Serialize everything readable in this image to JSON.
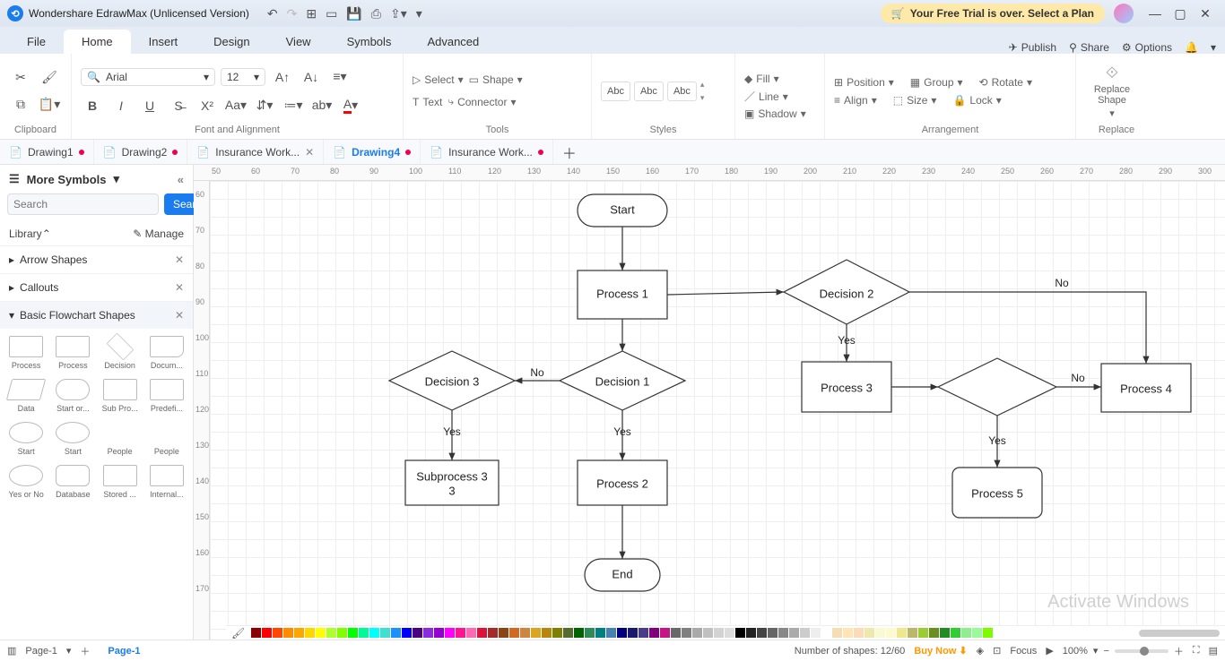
{
  "app_title": "Wondershare EdrawMax (Unlicensed Version)",
  "trial_msg": "Your Free Trial is over. Select a Plan",
  "menu": {
    "items": [
      "File",
      "Home",
      "Insert",
      "Design",
      "View",
      "Symbols",
      "Advanced"
    ],
    "active": "Home",
    "right": {
      "publish": "Publish",
      "share": "Share",
      "options": "Options"
    }
  },
  "ribbon": {
    "clipboard": "Clipboard",
    "font_name": "Arial",
    "font_size": "12",
    "font_group": "Font and Alignment",
    "select": "Select",
    "shape": "Shape",
    "text": "Text",
    "connector": "Connector",
    "tools": "Tools",
    "styles": "Styles",
    "abc": "Abc",
    "fill": "Fill",
    "line": "Line",
    "shadow": "Shadow",
    "position": "Position",
    "align": "Align",
    "group": "Group",
    "size": "Size",
    "rotate": "Rotate",
    "lock": "Lock",
    "arrangement": "Arrangement",
    "replace_shape": "Replace\nShape",
    "replace": "Replace"
  },
  "tabs": [
    {
      "label": "Drawing1",
      "dirty": true
    },
    {
      "label": "Drawing2",
      "dirty": true
    },
    {
      "label": "Insurance Work...",
      "dirty": false,
      "closable": true
    },
    {
      "label": "Drawing4",
      "dirty": true,
      "active": true
    },
    {
      "label": "Insurance Work...",
      "dirty": true
    }
  ],
  "left": {
    "more": "More Symbols",
    "search_ph": "Search",
    "search_btn": "Search",
    "library": "Library",
    "manage": "Manage",
    "cats": [
      "Arrow Shapes",
      "Callouts",
      "Basic Flowchart Shapes"
    ],
    "shapes": [
      "Process",
      "Process",
      "Decision",
      "Docum...",
      "Data",
      "Start or...",
      "Sub Pro...",
      "Predefi...",
      "Start",
      "Start",
      "People",
      "People",
      "Yes or No",
      "Database",
      "Stored ...",
      "Internal..."
    ]
  },
  "flowchart": {
    "start": "Start",
    "p1": "Process 1",
    "d1": "Decision 1",
    "d2": "Decision 2",
    "d3": "Decision 3",
    "p2": "Process 2",
    "p3": "Process 3",
    "p4": "Process 4",
    "p5": "Process 5",
    "sub3": "Subprocess 3",
    "end": "End",
    "yes": "Yes",
    "no": "No"
  },
  "ruler_h": [
    "50",
    "60",
    "70",
    "80",
    "90",
    "100",
    "110",
    "120",
    "130",
    "140",
    "150",
    "160",
    "170",
    "180",
    "190",
    "200",
    "210",
    "220",
    "230",
    "240",
    "250",
    "260",
    "270",
    "280",
    "290",
    "300"
  ],
  "ruler_v": [
    "60",
    "70",
    "80",
    "90",
    "100",
    "110",
    "120",
    "130",
    "140",
    "150",
    "160",
    "170"
  ],
  "status": {
    "page": "Page-1",
    "page_tab": "Page-1",
    "shapes": "Number of shapes: 12/60",
    "buy": "Buy Now",
    "focus": "Focus",
    "zoom": "100%"
  },
  "watermark": "Activate Windows"
}
